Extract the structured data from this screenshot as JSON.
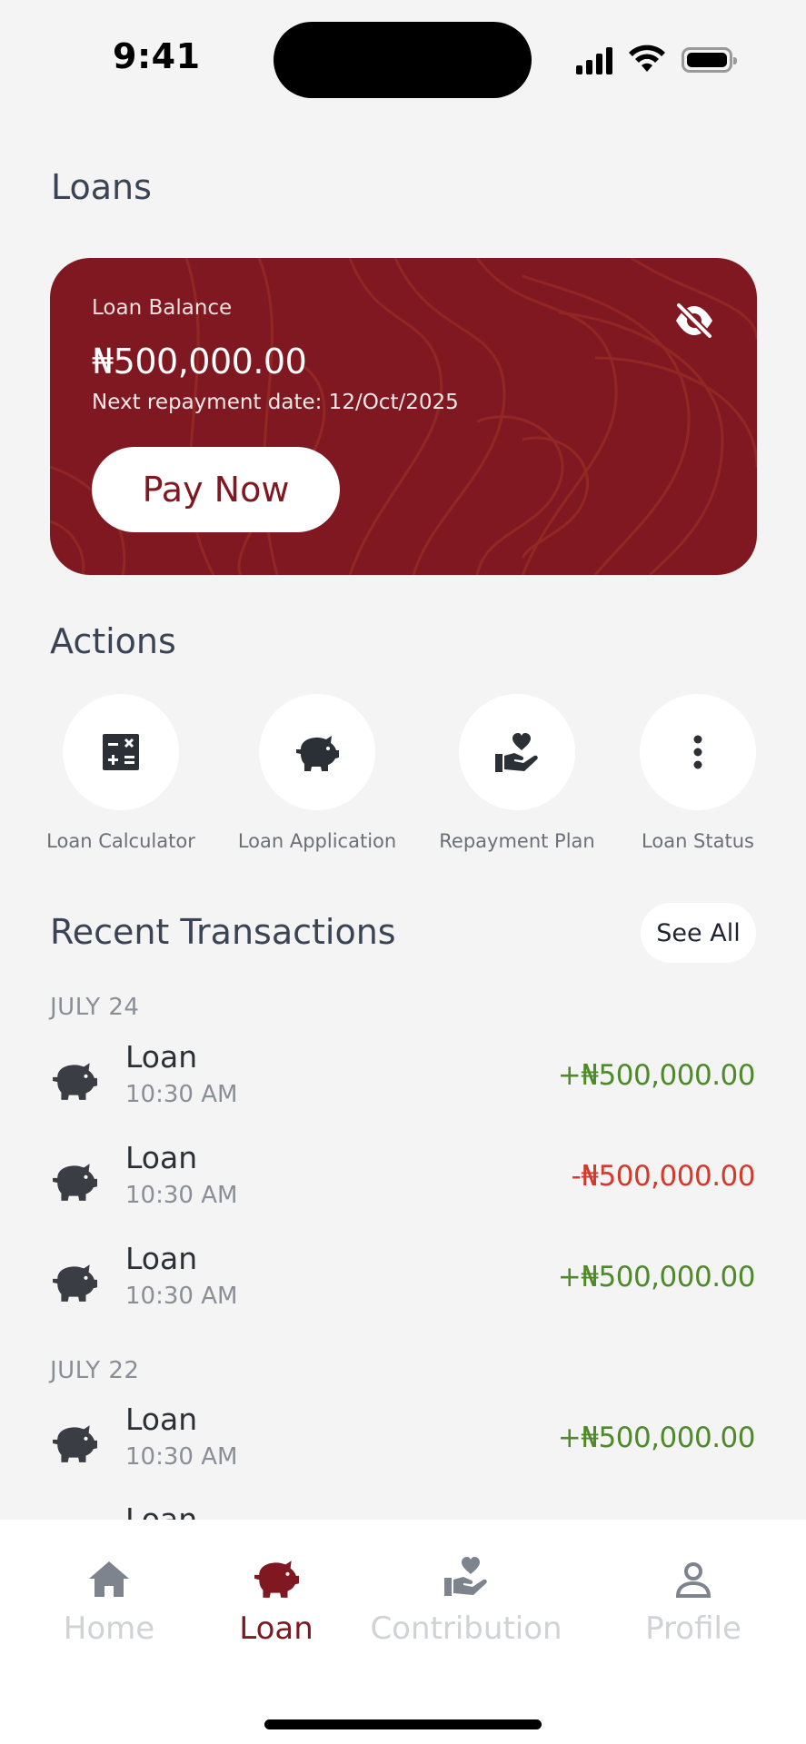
{
  "status_bar": {
    "time": "9:41"
  },
  "page": {
    "title": "Loans"
  },
  "loan_card": {
    "label": "Loan Balance",
    "amount": "₦500,000.00",
    "next_repayment": "Next repayment date: 12/Oct/2025",
    "pay_button": "Pay Now",
    "visibility_icon": "eye-off-icon"
  },
  "actions": {
    "title": "Actions",
    "items": [
      {
        "label": "Loan Calculator",
        "icon": "calculator-icon"
      },
      {
        "label": "Loan Application",
        "icon": "piggy-bank-icon"
      },
      {
        "label": "Repayment Plan",
        "icon": "hand-heart-icon"
      },
      {
        "label": "Loan Status",
        "icon": "more-vertical-icon"
      }
    ]
  },
  "transactions": {
    "title": "Recent Transactions",
    "see_all": "See All",
    "groups": [
      {
        "date": "JULY 24",
        "items": [
          {
            "name": "Loan",
            "time": "10:30 AM",
            "amount": "+₦500,000.00",
            "type": "credit"
          },
          {
            "name": "Loan",
            "time": "10:30 AM",
            "amount": "-₦500,000.00",
            "type": "debit"
          },
          {
            "name": "Loan",
            "time": "10:30 AM",
            "amount": "+₦500,000.00",
            "type": "credit"
          }
        ]
      },
      {
        "date": "JULY 22",
        "items": [
          {
            "name": "Loan",
            "time": "10:30 AM",
            "amount": "+₦500,000.00",
            "type": "credit"
          },
          {
            "name": "Loan"
          }
        ]
      }
    ]
  },
  "bottom_nav": {
    "items": [
      {
        "label": "Home",
        "icon": "home-icon",
        "active": false
      },
      {
        "label": "Loan",
        "icon": "piggy-bank-icon",
        "active": true
      },
      {
        "label": "Contribution",
        "icon": "hand-heart-icon",
        "active": false
      },
      {
        "label": "Profile",
        "icon": "user-icon",
        "active": false
      }
    ]
  },
  "colors": {
    "brand": "#7f1820",
    "credit": "#4e8a2a",
    "debit": "#d33a2c",
    "nav_inactive": "#d0d2d6",
    "background": "#f4f4f4"
  }
}
